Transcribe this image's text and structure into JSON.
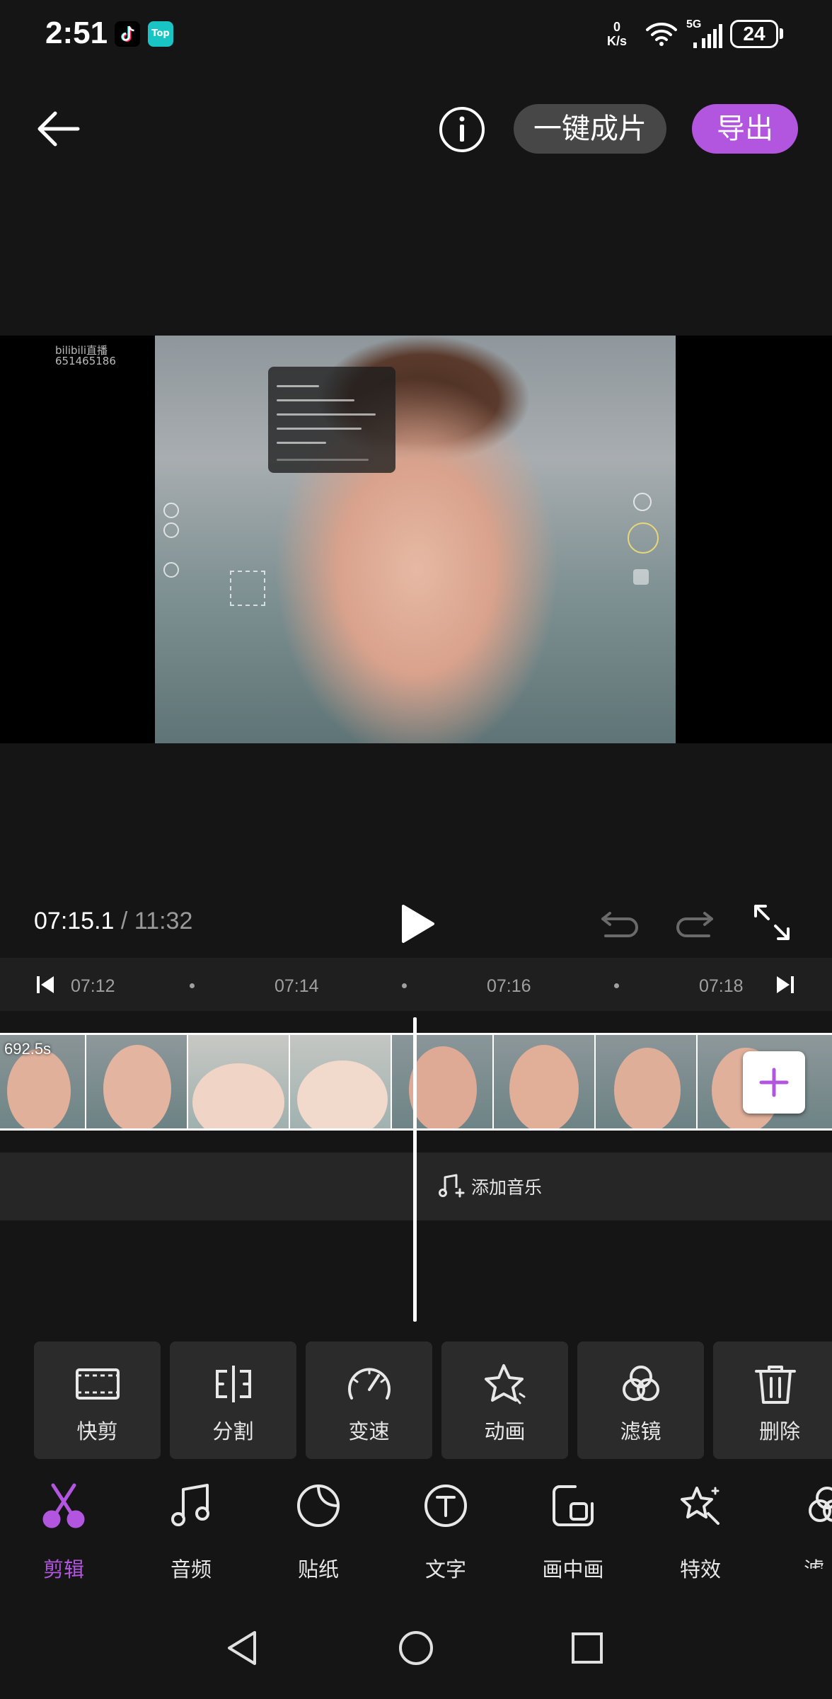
{
  "status_bar": {
    "time": "2:51",
    "app_icon_tiktok": "tiktok-icon",
    "app_icon_top": "Top",
    "net_speed_value": "0",
    "net_speed_unit": "K/s",
    "network": "5G",
    "battery": "24"
  },
  "header": {
    "back_icon": "arrow-left-icon",
    "info_icon": "info-circle-icon",
    "one_click_label": "一键成片",
    "export_label": "导出",
    "accent_color": "#b256e0"
  },
  "preview": {
    "watermark_line1": "bilibili直播",
    "watermark_line2": "651465186"
  },
  "playback": {
    "current_time": "07:15.1",
    "separator": " / ",
    "total_time": "11:32"
  },
  "ruler": {
    "ticks": [
      "07:12",
      "07:14",
      "07:16",
      "07:18"
    ]
  },
  "track": {
    "clip_duration": "692.5s",
    "add_music_label": "添加音乐"
  },
  "tools": [
    {
      "label": "快剪",
      "icon": "quick-cut-icon"
    },
    {
      "label": "分割",
      "icon": "split-icon"
    },
    {
      "label": "变速",
      "icon": "speed-gauge-icon"
    },
    {
      "label": "动画",
      "icon": "animation-star-icon"
    },
    {
      "label": "滤镜",
      "icon": "filter-circles-icon"
    },
    {
      "label": "删除",
      "icon": "trash-icon"
    }
  ],
  "bottom_nav": [
    {
      "label": "剪辑",
      "icon": "scissors-icon",
      "active": true
    },
    {
      "label": "音频",
      "icon": "music-note-icon"
    },
    {
      "label": "贴纸",
      "icon": "sticker-icon"
    },
    {
      "label": "文字",
      "icon": "text-icon"
    },
    {
      "label": "画中画",
      "icon": "picture-in-picture-icon"
    },
    {
      "label": "特效",
      "icon": "effects-icon"
    },
    {
      "label": "滤",
      "icon": "filter-icon"
    }
  ]
}
